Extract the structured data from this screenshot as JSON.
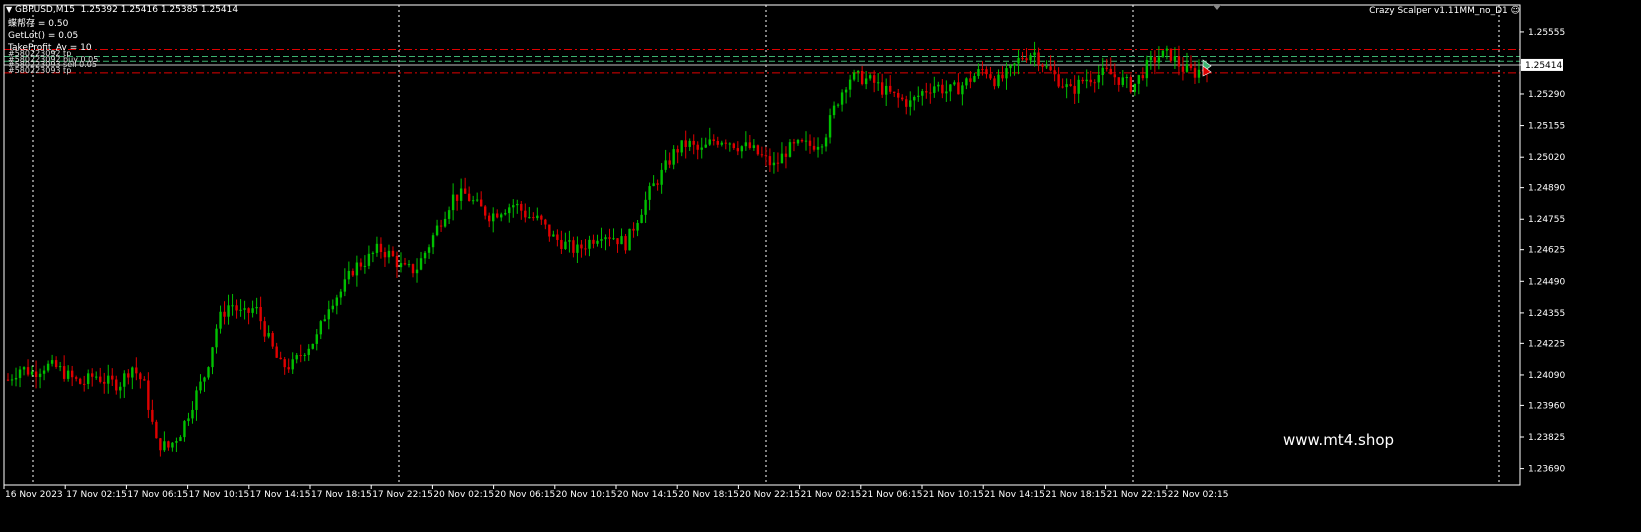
{
  "header": {
    "symbol": "GBPUSD,M15",
    "ohlc": "1.25392 1.25416 1.25385 1.25414",
    "ea_name": "Crazy Scalper v1.11MM_no_D1",
    "info_lines": [
      "蝶帮存 = 0.50",
      "GetLot() = 0.05",
      "TakeProfit_Av = 10"
    ],
    "order_labels": [
      "#580223092 tp",
      "#580223092 buy 0.05",
      "#580223093 sell 0.05",
      "#580223093 tp"
    ]
  },
  "watermark": "www.mt4.shop",
  "colors": {
    "bull": "#00c000",
    "bear": "#e00000",
    "grid": "#ffffff",
    "axis": "#ffffff",
    "bid_line": "#c0c0c0",
    "tp_line": "#e00000",
    "order_line": "#3cb371"
  },
  "icons": [
    "triangle-down-icon",
    "smiley-icon"
  ],
  "chart_data": {
    "type": "candlestick",
    "symbol": "GBPUSD",
    "timeframe": "M15",
    "current_price": "1.25414",
    "ylim": [
      1.2362,
      1.2567
    ],
    "y_ticks": [
      "1.25555",
      "1.25414",
      "1.25290",
      "1.25155",
      "1.25020",
      "1.24890",
      "1.24755",
      "1.24625",
      "1.24490",
      "1.24355",
      "1.24225",
      "1.24090",
      "1.23960",
      "1.23825",
      "1.23690"
    ],
    "x_ticks": [
      "16 Nov 2023",
      "17 Nov 02:15",
      "17 Nov 06:15",
      "17 Nov 10:15",
      "17 Nov 14:15",
      "17 Nov 18:15",
      "17 Nov 22:15",
      "20 Nov 02:15",
      "20 Nov 06:15",
      "20 Nov 10:15",
      "20 Nov 14:15",
      "20 Nov 18:15",
      "20 Nov 22:15",
      "21 Nov 02:15",
      "21 Nov 06:15",
      "21 Nov 10:15",
      "21 Nov 14:15",
      "21 Nov 18:15",
      "21 Nov 22:15",
      "22 Nov 02:15"
    ],
    "day_separators": [
      "16 Nov",
      "17 Nov",
      "20 Nov",
      "21 Nov",
      "22 Nov",
      "23 Nov"
    ],
    "order_levels": [
      {
        "label": "tp",
        "price": 1.2548,
        "kind": "tp"
      },
      {
        "label": "buy 0.05",
        "price": 1.2545,
        "kind": "order"
      },
      {
        "label": "sell 0.05",
        "price": 1.2543,
        "kind": "order"
      },
      {
        "label": "tp",
        "price": 1.2538,
        "kind": "tp"
      }
    ],
    "anchors": [
      1.2407,
      1.2412,
      1.241,
      1.2413,
      1.2412,
      1.2408,
      1.2405,
      1.2409,
      1.2406,
      1.2405,
      1.2413,
      1.2405,
      1.238,
      1.2378,
      1.2385,
      1.2398,
      1.241,
      1.2432,
      1.244,
      1.2434,
      1.2438,
      1.2425,
      1.2413,
      1.2413,
      1.242,
      1.2425,
      1.244,
      1.2445,
      1.2455,
      1.2458,
      1.2463,
      1.246,
      1.2454,
      1.2454,
      1.2464,
      1.2475,
      1.2485,
      1.2486,
      1.2481,
      1.2477,
      1.248,
      1.2482,
      1.2477,
      1.2475,
      1.2468,
      1.2465,
      1.2462,
      1.2466,
      1.247,
      1.2468,
      1.2465,
      1.2477,
      1.2488,
      1.2496,
      1.2505,
      1.2508,
      1.2504,
      1.2509,
      1.251,
      1.2507,
      1.2506,
      1.2502,
      1.2498,
      1.2505,
      1.2507,
      1.2507,
      1.251,
      1.2525,
      1.2536,
      1.2536,
      1.2534,
      1.253,
      1.2527,
      1.2525,
      1.253,
      1.2533,
      1.253,
      1.2532,
      1.2536,
      1.254,
      1.2534,
      1.2538,
      1.2545,
      1.2547,
      1.254,
      1.2535,
      1.253,
      1.2535,
      1.2537,
      1.2538,
      1.2535,
      1.2532,
      1.254,
      1.2545,
      1.2546,
      1.254,
      1.2538,
      1.2541
    ]
  }
}
